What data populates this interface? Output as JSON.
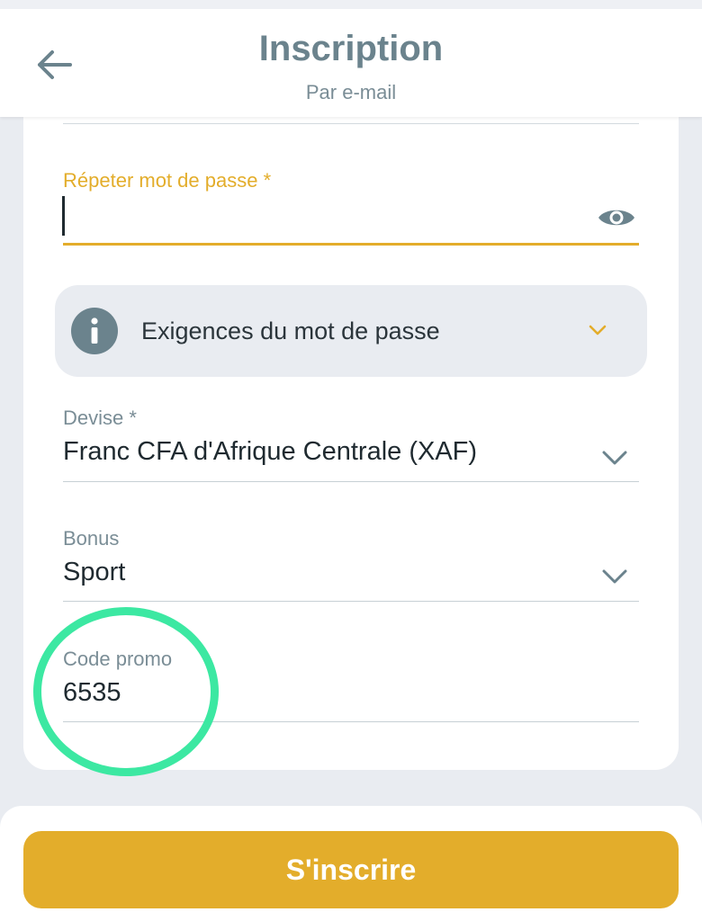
{
  "header": {
    "title": "Inscription",
    "subtitle": "Par e-mail",
    "back_icon": "arrow-left-icon"
  },
  "form": {
    "repeat_password": {
      "label": "Répeter mot de passe *",
      "value": "",
      "state": "focused",
      "visibility_icon": "eye-icon"
    },
    "password_requirements": {
      "label": "Exigences du mot de passe",
      "icon": "info-icon",
      "expand_icon": "chevron-down-icon",
      "expanded": false
    },
    "currency": {
      "label": "Devise *",
      "value": "Franc CFA d'Afrique Centrale (XAF)"
    },
    "bonus": {
      "label": "Bonus",
      "value": "Sport"
    },
    "promo_code": {
      "label": "Code promo",
      "value": "6535"
    }
  },
  "submit": {
    "label": "S'inscrire"
  },
  "colors": {
    "accent": "#e3ad2b",
    "header_text": "#6b838d",
    "muted_text": "#7a8d96",
    "background": "#e9ecf1",
    "highlight_circle": "#3ce8a2"
  }
}
